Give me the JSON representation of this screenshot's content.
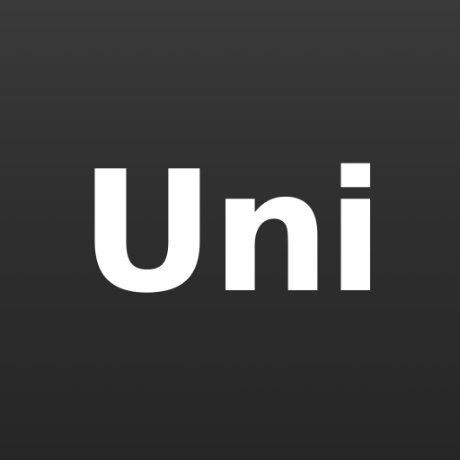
{
  "logo": {
    "text": "Uni",
    "text_color": "#ffffff",
    "background_top": "#3a3a3a",
    "background_bottom": "#262626"
  }
}
